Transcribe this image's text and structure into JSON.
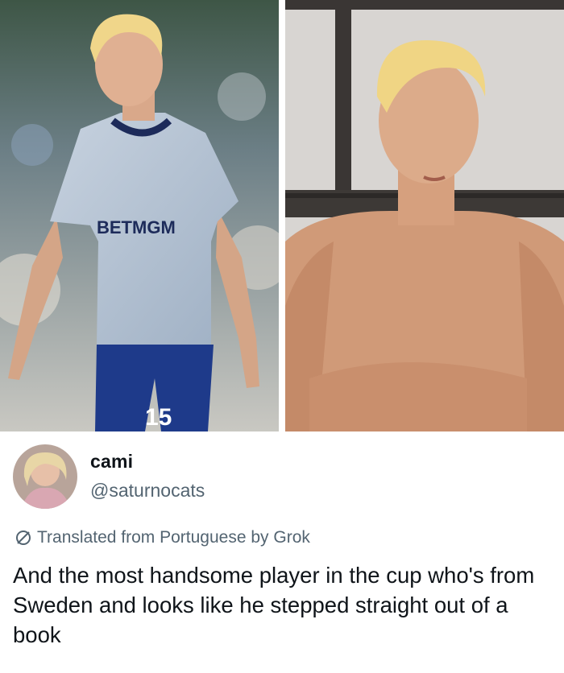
{
  "left_photo": {
    "jersey_sponsor": "BETMGM",
    "shorts_number": "15"
  },
  "tweet": {
    "display_name": "cami",
    "handle": "@saturnocats",
    "translation_note": "Translated from Portuguese by Grok",
    "text": "And the most handsome player in the cup who's from Sweden and looks like he stepped straight out of a book"
  },
  "icons": {
    "translate": "globe-slash-icon"
  },
  "colors": {
    "text_primary": "#0f1419",
    "text_secondary": "#536471",
    "background": "#ffffff"
  }
}
